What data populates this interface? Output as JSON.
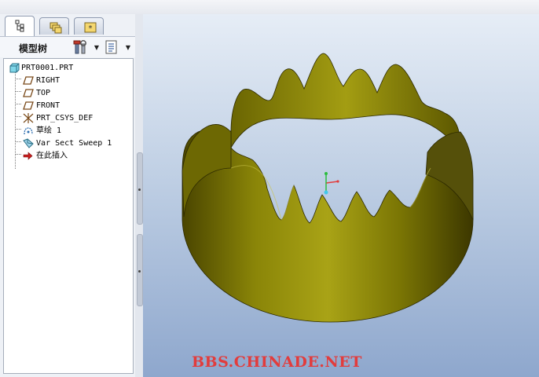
{
  "panel": {
    "title": "模型树",
    "tabs": [
      "model-tree-tab",
      "folder-browser-tab",
      "favorites-tab"
    ]
  },
  "tree": {
    "items": [
      {
        "label": "PRT0001.PRT",
        "icon": "part-icon"
      },
      {
        "label": "RIGHT",
        "icon": "datum-plane-icon"
      },
      {
        "label": "TOP",
        "icon": "datum-plane-icon"
      },
      {
        "label": "FRONT",
        "icon": "datum-plane-icon"
      },
      {
        "label": "PRT_CSYS_DEF",
        "icon": "csys-icon"
      },
      {
        "label": "草绘 1",
        "icon": "sketch-icon"
      },
      {
        "label": "Var Sect Sweep 1",
        "icon": "sweep-icon"
      },
      {
        "label": "在此插入",
        "icon": "insert-here-arrow-icon"
      }
    ]
  },
  "viewport": {
    "watermark": "BBS.CHINADE.NET",
    "model_color": "#7d7a05"
  }
}
